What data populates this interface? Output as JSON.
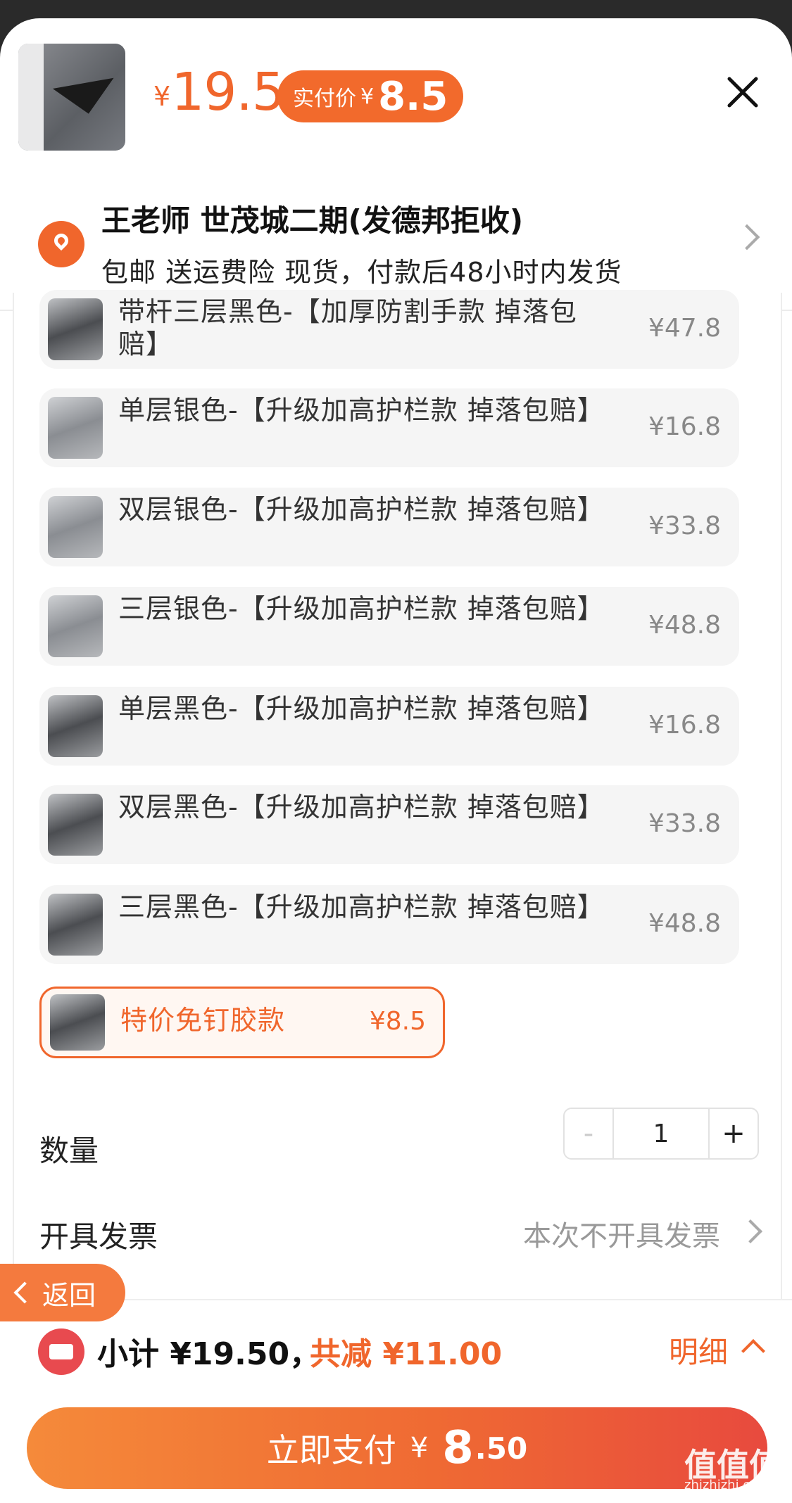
{
  "header": {
    "original_price_symbol": "¥",
    "original_price": "19.5",
    "pay_label": "实付价",
    "pay_symbol": "¥",
    "pay_amount": "8.5"
  },
  "address": {
    "name_line": "王老师 世茂城二期(发德邦拒收)",
    "shipping_line": "包邮  送运费险  现货，付款后48小时内发货"
  },
  "options": [
    {
      "name": "带杆三层黑色-【加厚防割手款 掉落包赔】",
      "price": "¥47.8"
    },
    {
      "name": "单层银色-【升级加高护栏款 掉落包赔】",
      "price": "¥16.8"
    },
    {
      "name": "双层银色-【升级加高护栏款 掉落包赔】",
      "price": "¥33.8"
    },
    {
      "name": "三层银色-【升级加高护栏款 掉落包赔】",
      "price": "¥48.8"
    },
    {
      "name": "单层黑色-【升级加高护栏款 掉落包赔】",
      "price": "¥16.8"
    },
    {
      "name": "双层黑色-【升级加高护栏款 掉落包赔】",
      "price": "¥33.8"
    },
    {
      "name": "三层黑色-【升级加高护栏款 掉落包赔】",
      "price": "¥48.8"
    }
  ],
  "selected_option": {
    "name": "特价免钉胶款",
    "price": "¥8.5"
  },
  "quantity": {
    "label": "数量",
    "minus": "-",
    "value": "1",
    "plus": "+"
  },
  "invoice": {
    "label": "开具发票",
    "value": "本次不开具发票"
  },
  "back": {
    "label": "返回"
  },
  "summary": {
    "subtotal": "小计 ¥19.50，",
    "discount": "共减 ¥11.00",
    "detail": "明细"
  },
  "pay_button": {
    "label": "立即支付",
    "symbol": "¥",
    "amount_int": "8",
    "amount_dec": ".50"
  },
  "watermark": {
    "main": "值值值",
    "sub": "zhizhizhi.com"
  },
  "colors": {
    "accent": "#f0662c",
    "coupon": "#e84a4f",
    "pay_gradient_end": "#e84a3e"
  }
}
